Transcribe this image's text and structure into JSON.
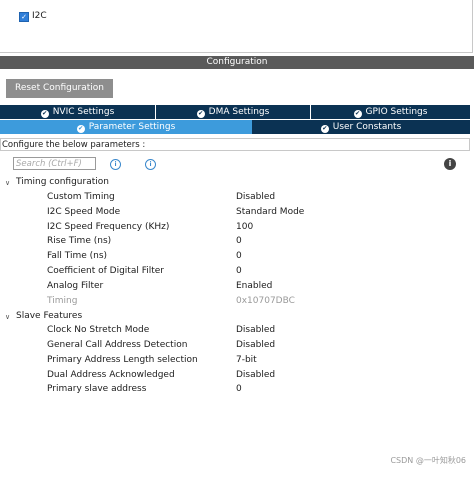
{
  "peripheral": {
    "name": "I2C",
    "checked": true
  },
  "config_title": "Configuration",
  "reset_button": "Reset Configuration",
  "tabs": {
    "nvic": "NVIC Settings",
    "dma": "DMA Settings",
    "gpio": "GPIO Settings",
    "params": "Parameter Settings",
    "user_constants": "User Constants"
  },
  "configure_text": "Configure the below parameters :",
  "search": {
    "placeholder": "Search (Ctrl+F)"
  },
  "groups": [
    {
      "label": "Timing configuration",
      "params": [
        {
          "name": "Custom Timing",
          "value": "Disabled"
        },
        {
          "name": "I2C Speed Mode",
          "value": "Standard Mode"
        },
        {
          "name": "I2C Speed Frequency (KHz)",
          "value": "100"
        },
        {
          "name": "Rise Time (ns)",
          "value": "0"
        },
        {
          "name": "Fall Time (ns)",
          "value": "0"
        },
        {
          "name": "Coefficient of Digital Filter",
          "value": "0"
        },
        {
          "name": "Analog Filter",
          "value": "Enabled"
        },
        {
          "name": "Timing",
          "value": "0x10707DBC"
        }
      ]
    },
    {
      "label": "Slave Features",
      "params": [
        {
          "name": "Clock No Stretch Mode",
          "value": "Disabled"
        },
        {
          "name": "General Call Address Detection",
          "value": "Disabled"
        },
        {
          "name": "Primary Address Length selection",
          "value": "7-bit"
        },
        {
          "name": "Dual Address Acknowledged",
          "value": "Disabled"
        },
        {
          "name": "Primary slave address",
          "value": "0"
        }
      ]
    }
  ],
  "watermark": "CSDN @一叶知秋06",
  "colors": {
    "tab_dark": "#0b3253",
    "tab_light": "#3d9bdc",
    "config_bar": "#5a5a5a",
    "reset_button": "#8e8e8e"
  },
  "icons": {
    "tab_status": "check-circle-icon",
    "search_prev": "info-circle-icon",
    "search_next": "info-circle-icon",
    "info": "info-icon"
  }
}
